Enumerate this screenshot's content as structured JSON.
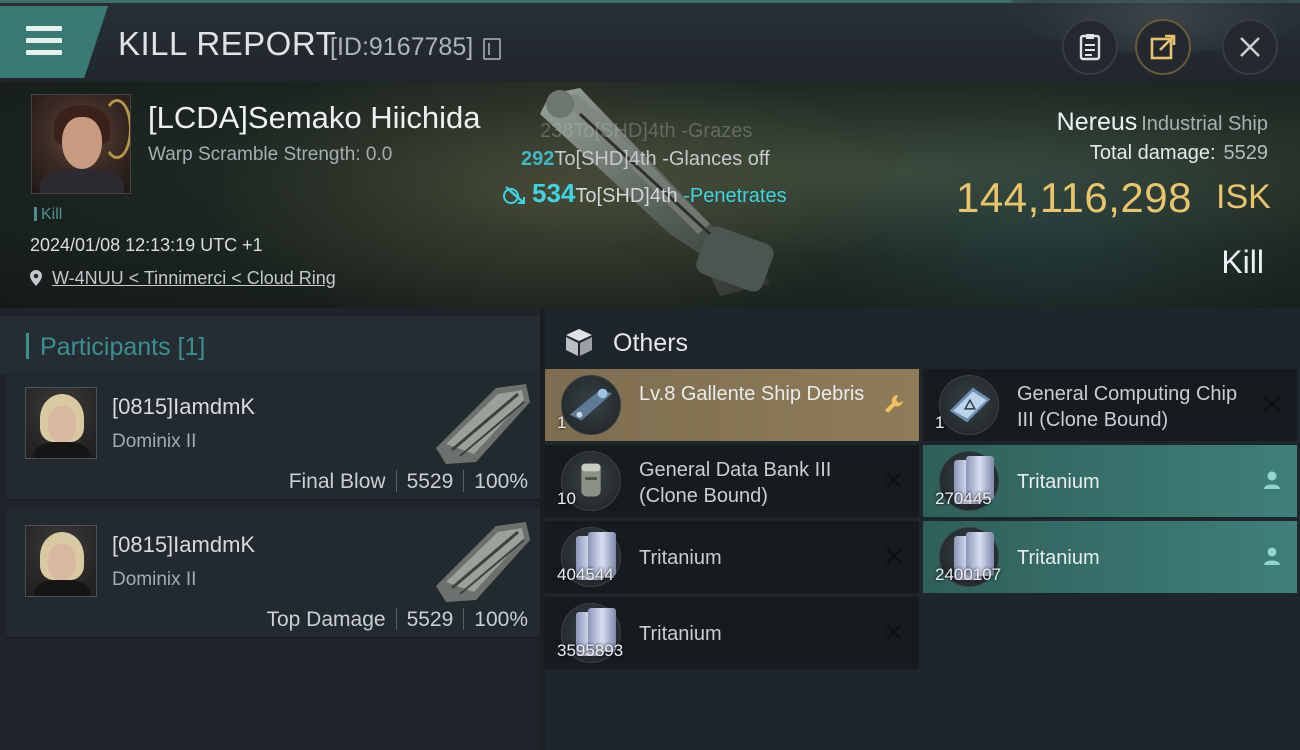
{
  "header": {
    "title": "KILL REPORT",
    "report_id": "[ID:9167785]"
  },
  "victim": {
    "name": "[LCDA]Semako Hiichida",
    "scramble": "Warp Scramble Strength: 0.0",
    "kill_tag": "Kill",
    "datetime": "2024/01/08 12:13:19 UTC +1",
    "location": "W-4NUU < Tinnimerci < Cloud Ring",
    "ship_name": "Nereus",
    "ship_class": "Industrial Ship",
    "total_damage_label": "Total damage:",
    "total_damage": "5529",
    "isk_value": "144,116,298",
    "isk_unit": "ISK",
    "result": "Kill"
  },
  "hitlog": [
    {
      "amount": "238",
      "target": "To[SHD]4th",
      "result": "-Grazes"
    },
    {
      "amount": "292",
      "target": "To[SHD]4th",
      "result": "-Glances off"
    },
    {
      "amount": "534",
      "target": "To[SHD]4th",
      "result": "-Penetrates"
    }
  ],
  "participants": {
    "label": "Participants [1]",
    "rows": [
      {
        "name": "[0815]IamdmK",
        "ship": "Dominix II",
        "role": "Final Blow",
        "damage": "5529",
        "percent": "100%"
      },
      {
        "name": "[0815]IamdmK",
        "ship": "Dominix II",
        "role": "Top Damage",
        "damage": "5529",
        "percent": "100%"
      }
    ]
  },
  "others": {
    "label": "Others",
    "items": [
      {
        "qty": "1",
        "name": "Lv.8 Gallente Ship Debris",
        "icon": "ship-debris-icon",
        "action": "wrench-icon",
        "state": "highlight"
      },
      {
        "qty": "1",
        "name": "General Computing Chip III (Clone Bound)",
        "icon": "computing-chip-icon",
        "action": "close-icon",
        "state": "dropped"
      },
      {
        "qty": "10",
        "name": "General Data Bank III (Clone Bound)",
        "icon": "data-bank-icon",
        "action": "close-icon",
        "state": "dropped"
      },
      {
        "qty": "270445",
        "name": "Tritanium",
        "icon": "tritanium-icon",
        "action": "person-icon",
        "state": "looted"
      },
      {
        "qty": "404544",
        "name": "Tritanium",
        "icon": "tritanium-icon",
        "action": "close-icon",
        "state": "dropped"
      },
      {
        "qty": "2400107",
        "name": "Tritanium",
        "icon": "tritanium-icon",
        "action": "person-icon",
        "state": "looted"
      },
      {
        "qty": "3595893",
        "name": "Tritanium",
        "icon": "tritanium-icon",
        "action": "close-icon",
        "state": "dropped"
      }
    ]
  },
  "colors": {
    "accent_teal": "#3a7a74",
    "isk_gold": "#e9c46a",
    "hit_cyan": "#3fd3e3",
    "highlight_gold": "#8e7c59"
  }
}
